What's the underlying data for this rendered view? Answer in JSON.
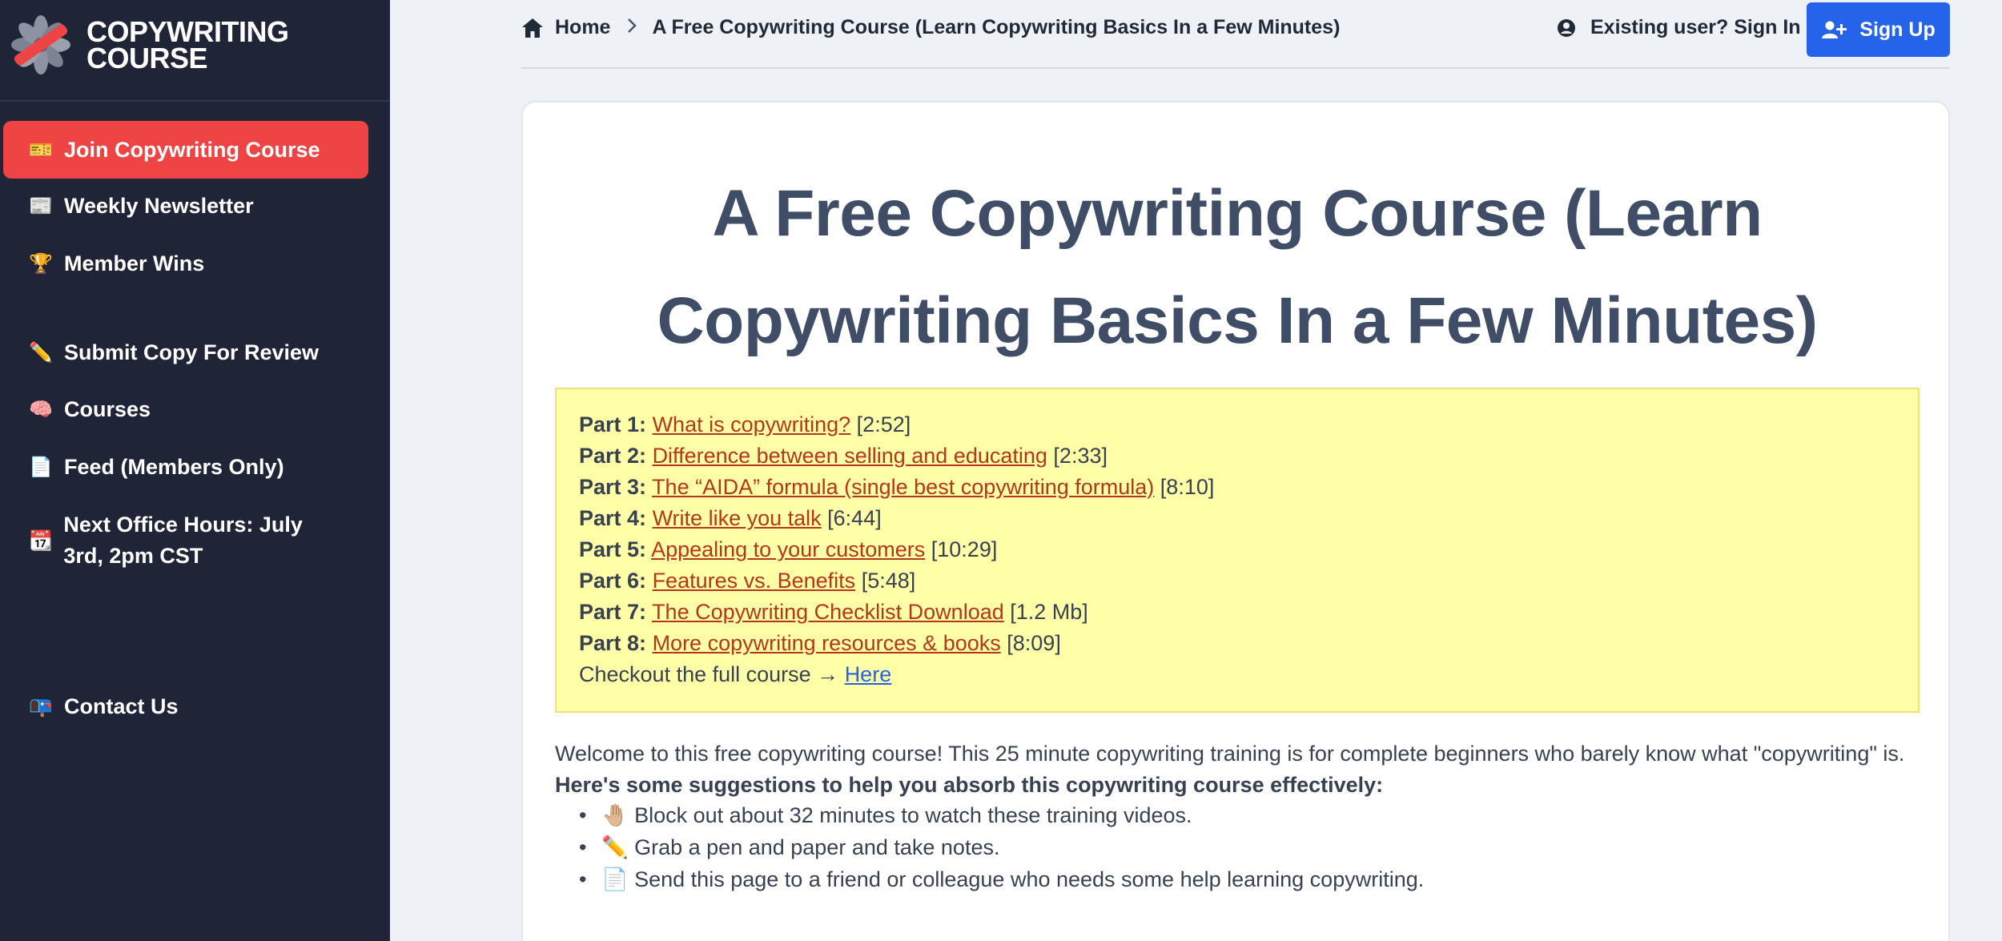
{
  "brand": {
    "line1": "COPYWRITING",
    "line2": "COURSE"
  },
  "sidebar": {
    "items": [
      {
        "emoji": "🎫",
        "label": "Join Copywriting Course"
      },
      {
        "emoji": "📰",
        "label": "Weekly Newsletter"
      },
      {
        "emoji": "🏆",
        "label": "Member Wins"
      },
      {
        "emoji": "✏️",
        "label": "Submit Copy For Review"
      },
      {
        "emoji": "🧠",
        "label": "Courses"
      },
      {
        "emoji": "📄",
        "label": "Feed (Members Only)"
      },
      {
        "emoji": "📆",
        "label": "Next Office Hours: July 3rd, 2pm CST"
      },
      {
        "emoji": "📭",
        "label": "Contact Us"
      }
    ]
  },
  "header": {
    "breadcrumb": {
      "home": "Home",
      "current": "A Free Copywriting Course (Learn Copywriting Basics In a Few Minutes)"
    },
    "signin_label": "Existing user? Sign In",
    "signup_label": "Sign Up"
  },
  "article": {
    "title": "A Free Copywriting Course (Learn Copywriting Basics In a Few Minutes)",
    "toc": [
      {
        "part": "Part 1:",
        "link": "What is copywriting?",
        "meta": "[2:52]"
      },
      {
        "part": "Part 2:",
        "link": "Difference between selling and educating",
        "meta": "[2:33]"
      },
      {
        "part": "Part 3:",
        "link": "The “AIDA” formula (single best copywriting formula)",
        "meta": "[8:10]"
      },
      {
        "part": "Part 4:",
        "link": "Write like you talk",
        "meta": "[6:44]"
      },
      {
        "part": "Part 5:",
        "link": "Appealing to your customers",
        "meta": "[10:29]"
      },
      {
        "part": "Part 6:",
        "link": "Features vs. Benefits",
        "meta": "[5:48]"
      },
      {
        "part": "Part 7:",
        "link": "The Copywriting Checklist Download",
        "meta": "[1.2 Mb]"
      },
      {
        "part": "Part 8:",
        "link": "More copywriting resources & books",
        "meta": "[8:09]"
      }
    ],
    "full_course_text": "Checkout the full course →",
    "full_course_link": "Here",
    "intro": "Welcome to this free copywriting course! This 25 minute copywriting training is for complete beginners who barely know what \"copywriting\" is.",
    "suggestions_heading": "Here's some suggestions to help you absorb this copywriting course effectively:",
    "bullets": [
      "🤚🏼 Block out about 32 minutes to watch these training videos.",
      "✏️ Grab a pen and paper and take notes.",
      "📄 Send this page to a friend or colleague who needs some help learning copywriting."
    ]
  },
  "colors": {
    "sidebar_bg": "#1f2537",
    "active_item": "#ef4444",
    "signup_button": "#2563eb",
    "toc_bg": "#ffffa7",
    "link": "#b4371b"
  }
}
